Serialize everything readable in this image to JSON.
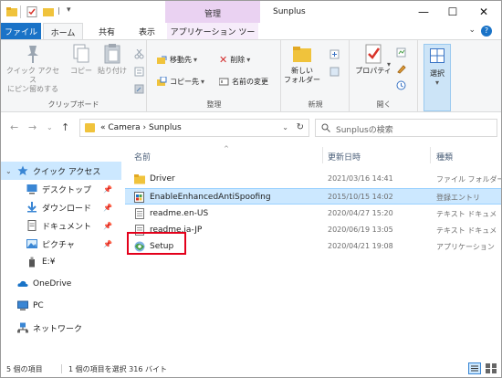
{
  "window": {
    "title": "Sunplus",
    "context_tab_group": "管理",
    "buttons": {
      "minimize": "—",
      "maximize": "☐",
      "close": "✕"
    }
  },
  "ribbon_tabs": [
    "ファイル",
    "ホーム",
    "共有",
    "表示",
    "アプリケーション ツール"
  ],
  "ribbon": {
    "clipboard": {
      "label": "クリップボード",
      "pin": "クイック アクセス\nにピン留めする",
      "copy": "コピー",
      "paste": "貼り付け"
    },
    "organize": {
      "label": "整理",
      "move_to": "移動先",
      "copy_to": "コピー先",
      "delete": "削除",
      "rename": "名前の変更"
    },
    "new": {
      "label": "新規",
      "new_folder": "新しい\nフォルダー"
    },
    "open": {
      "label": "開く",
      "properties": "プロパティ"
    },
    "select": {
      "label": "選択"
    }
  },
  "address_bar": {
    "path": "« Camera › Sunplus",
    "search_placeholder": "Sunplusの検索"
  },
  "nav_pane": [
    {
      "label": "クイック アクセス",
      "icon": "star-icon",
      "pinned": false,
      "selected": true
    },
    {
      "label": "デスクトップ",
      "icon": "desktop-icon",
      "pinned": true
    },
    {
      "label": "ダウンロード",
      "icon": "download-icon",
      "pinned": true
    },
    {
      "label": "ドキュメント",
      "icon": "documents-icon",
      "pinned": true
    },
    {
      "label": "ピクチャ",
      "icon": "pictures-icon",
      "pinned": true
    },
    {
      "label": "E:¥",
      "icon": "usb-drive-icon",
      "pinned": false
    },
    {
      "label": "OneDrive",
      "icon": "cloud-icon",
      "pinned": false
    },
    {
      "label": "PC",
      "icon": "pc-icon",
      "pinned": false
    },
    {
      "label": "ネットワーク",
      "icon": "network-icon",
      "pinned": false
    }
  ],
  "columns": {
    "name": "名前",
    "modified": "更新日時",
    "type": "種類"
  },
  "files": [
    {
      "name": "Driver",
      "modified": "2021/03/16 14:41",
      "type": "ファイル フォルダー",
      "icon": "folder-icon"
    },
    {
      "name": "EnableEnhancedAntiSpoofing",
      "modified": "2015/10/15 14:02",
      "type": "登録エントリ",
      "icon": "registry-icon",
      "selected": true
    },
    {
      "name": "readme.en-US",
      "modified": "2020/04/27 15:20",
      "type": "テキスト ドキュメ",
      "icon": "text-file-icon"
    },
    {
      "name": "readme.ja-JP",
      "modified": "2020/06/19 13:05",
      "type": "テキスト ドキュメ",
      "icon": "text-file-icon"
    },
    {
      "name": "Setup",
      "modified": "2020/04/21 19:08",
      "type": "アプリケーション",
      "icon": "setup-app-icon",
      "highlighted": true
    }
  ],
  "status": {
    "item_count": "5 個の項目",
    "selection": "1 個の項目を選択  316 バイト"
  },
  "colors": {
    "file_tab": "#1a73c7",
    "manage_tab": "#ead2f2",
    "selection": "#cce8ff",
    "highlight_box": "#e3001b"
  }
}
